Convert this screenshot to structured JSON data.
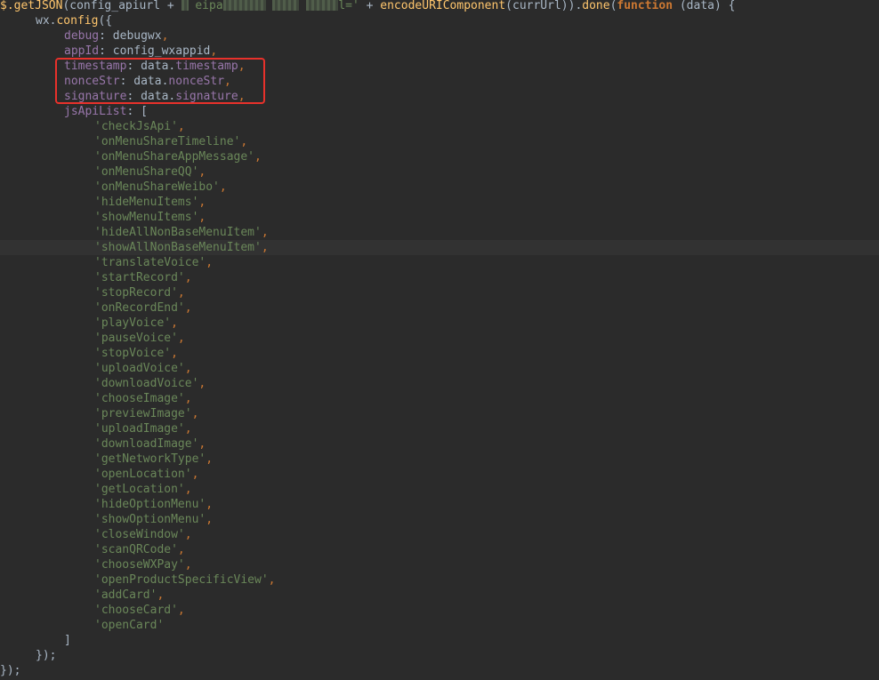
{
  "code": {
    "line1": {
      "getjson": "$.getJSON",
      "open": "(config_apiurl + ",
      "obscured_a": "eipa",
      "obscured_b": "l='",
      "plus": " + ",
      "encode": "encodeURIComponent",
      "args": "(currUrl)).",
      "done": "done",
      "paren": "(",
      "function_kw": "function",
      "tail": " (data) {"
    },
    "wx_config": {
      "obj": "wx.",
      "fn": "config",
      "open": "({"
    },
    "debug": {
      "key": "debug",
      "sep": ": ",
      "value": "debugwx"
    },
    "appId": {
      "key": "appId",
      "sep": ": ",
      "value": "config_wxappid"
    },
    "timestamp": {
      "key": "timestamp",
      "sep": ": ",
      "obj": "data.",
      "prop": "timestamp"
    },
    "nonceStr": {
      "key": "nonceStr",
      "sep": ": ",
      "obj": "data.",
      "prop": "nonceStr"
    },
    "signature": {
      "key": "signature",
      "sep": ": ",
      "obj": "data.",
      "prop": "signature"
    },
    "jsApiList": {
      "key": "jsApiList",
      "sep": ": ",
      "open": "["
    },
    "apis": [
      "'checkJsApi'",
      "'onMenuShareTimeline'",
      "'onMenuShareAppMessage'",
      "'onMenuShareQQ'",
      "'onMenuShareWeibo'",
      "'hideMenuItems'",
      "'showMenuItems'",
      "'hideAllNonBaseMenuItem'",
      "'showAllNonBaseMenuItem'",
      "'translateVoice'",
      "'startRecord'",
      "'stopRecord'",
      "'onRecordEnd'",
      "'playVoice'",
      "'pauseVoice'",
      "'stopVoice'",
      "'uploadVoice'",
      "'downloadVoice'",
      "'chooseImage'",
      "'previewImage'",
      "'uploadImage'",
      "'downloadImage'",
      "'getNetworkType'",
      "'openLocation'",
      "'getLocation'",
      "'hideOptionMenu'",
      "'showOptionMenu'",
      "'closeWindow'",
      "'scanQRCode'",
      "'chooseWXPay'",
      "'openProductSpecificView'",
      "'addCard'",
      "'chooseCard'",
      "'openCard'"
    ],
    "array_close": "]",
    "config_close": "});",
    "outer_close": "});",
    "comma": ",",
    "semicolon": ";"
  },
  "colors": {
    "background": "#2b2b2b",
    "plain": "#a9b7c6",
    "function": "#ffc66d",
    "keyword": "#cc7832",
    "property": "#9876aa",
    "string": "#6a8759",
    "highlight_box": "#e8312b"
  }
}
